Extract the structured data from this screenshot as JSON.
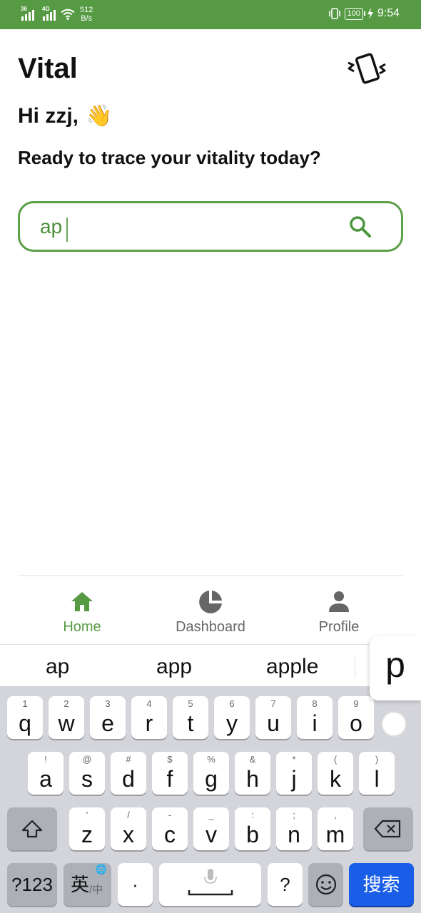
{
  "status_bar": {
    "sim1": "36",
    "sim2": "4G",
    "net_speed_value": "512",
    "net_speed_unit": "B/s",
    "battery": "100",
    "time": "9:54"
  },
  "header": {
    "app_title": "Vital",
    "greeting": "Hi zzj,",
    "greeting_emoji": "👋",
    "subtitle": "Ready to trace your vitality today?",
    "shake_icon": "phone-shake-icon"
  },
  "search": {
    "value": "ap",
    "icon": "search-icon",
    "accent_color": "#5b9f47"
  },
  "bottom_nav": {
    "items": [
      {
        "label": "Home",
        "icon": "home-icon",
        "active": true
      },
      {
        "label": "Dashboard",
        "icon": "pie-chart-icon",
        "active": false
      },
      {
        "label": "Profile",
        "icon": "person-icon",
        "active": false
      }
    ],
    "active_color": "#569b44",
    "inactive_color": "#666666"
  },
  "keyboard": {
    "suggestions": [
      "ap",
      "app",
      "apple"
    ],
    "popup_key": "p",
    "row1": [
      {
        "sub": "1",
        "main": "q"
      },
      {
        "sub": "2",
        "main": "w"
      },
      {
        "sub": "3",
        "main": "e"
      },
      {
        "sub": "4",
        "main": "r"
      },
      {
        "sub": "5",
        "main": "t"
      },
      {
        "sub": "6",
        "main": "y"
      },
      {
        "sub": "7",
        "main": "u"
      },
      {
        "sub": "8",
        "main": "i"
      },
      {
        "sub": "9",
        "main": "o"
      }
    ],
    "row2": [
      {
        "sub": "!",
        "main": "a"
      },
      {
        "sub": "@",
        "main": "s"
      },
      {
        "sub": "#",
        "main": "d"
      },
      {
        "sub": "$",
        "main": "f"
      },
      {
        "sub": "%",
        "main": "g"
      },
      {
        "sub": "&",
        "main": "h"
      },
      {
        "sub": "*",
        "main": "j"
      },
      {
        "sub": "(",
        "main": "k"
      },
      {
        "sub": ")",
        "main": "l"
      }
    ],
    "row3": [
      {
        "sub": "'",
        "main": "z"
      },
      {
        "sub": "/",
        "main": "x"
      },
      {
        "sub": "-",
        "main": "c"
      },
      {
        "sub": "_",
        "main": "v"
      },
      {
        "sub": ":",
        "main": "b"
      },
      {
        "sub": ";",
        "main": "n"
      },
      {
        "sub": ",",
        "main": "m"
      }
    ],
    "num_key": "?123",
    "lang_key_main": "英",
    "lang_key_sub": "/中",
    "dot_key": "·",
    "question_key": "?",
    "search_key": "搜索",
    "search_key_color": "#1a5ee8"
  }
}
